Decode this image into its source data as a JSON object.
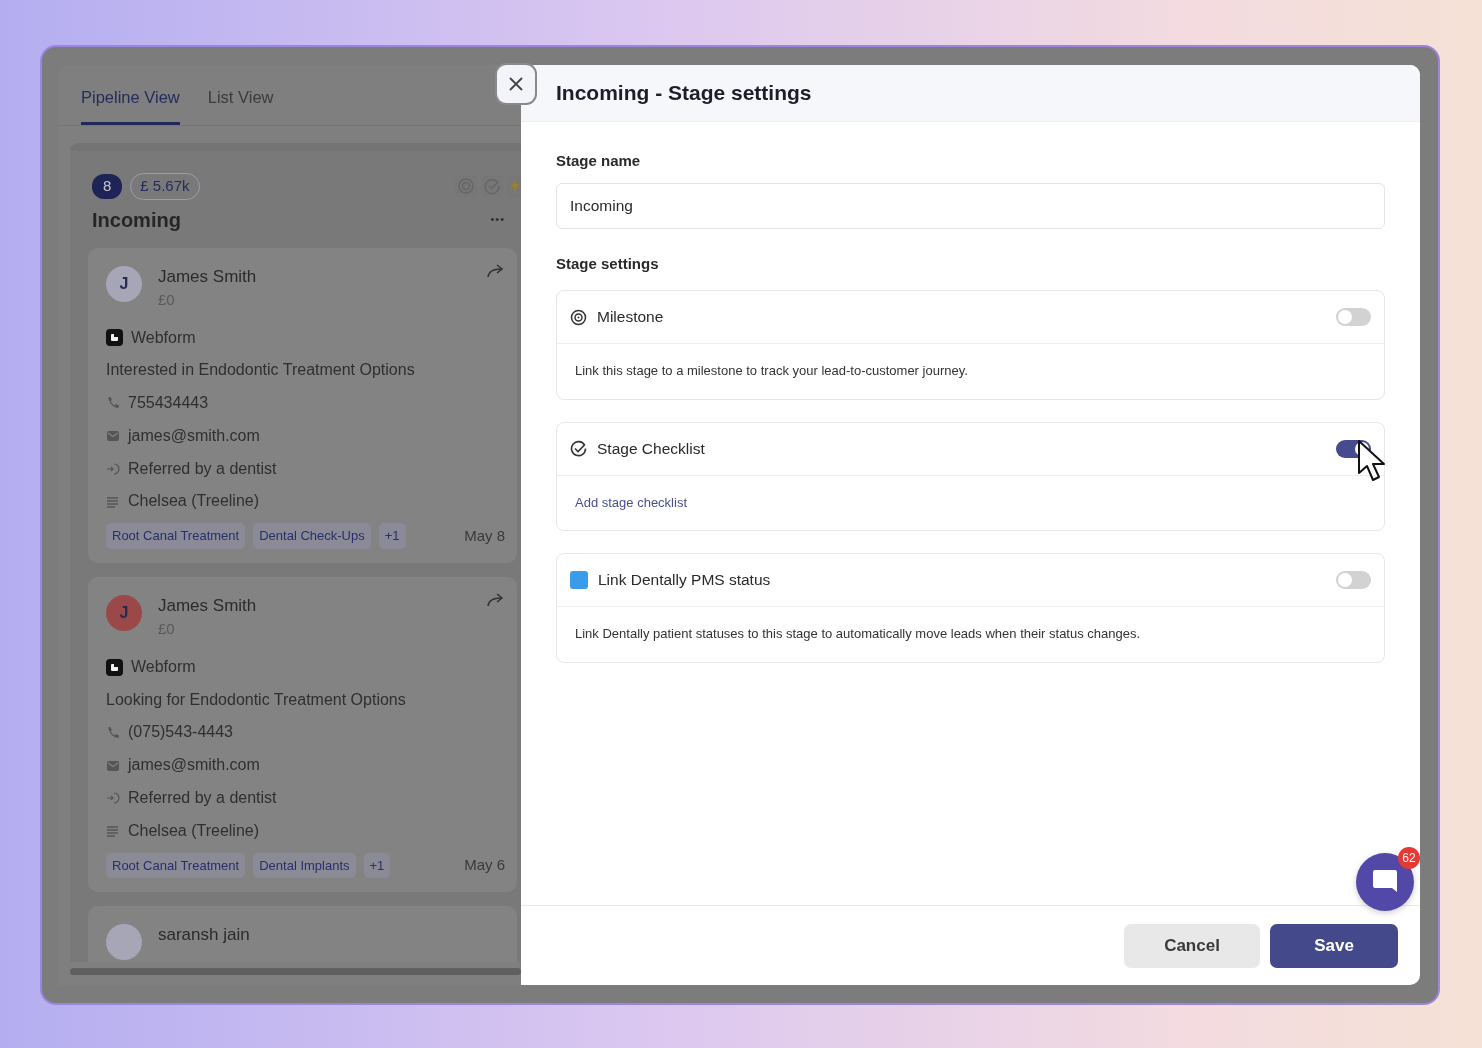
{
  "tabs": [
    {
      "label": "Pipeline View",
      "selected": true
    },
    {
      "label": "List View",
      "selected": false
    }
  ],
  "column": {
    "count": "8",
    "value": "£ 5.67k",
    "title": "Incoming",
    "menu": "•••",
    "cards": [
      {
        "initial": "J",
        "color": "#a7a6b6",
        "name": "James Smith",
        "amount": "£0",
        "source": "Webform",
        "description": "Interested in Endodontic Treatment Options",
        "phone": "755434443",
        "email": "james@smith.com",
        "referral": "Referred by a dentist",
        "location": "Chelsea (Treeline)",
        "tags": [
          "Root Canal Treatment",
          "Dental Check-Ups"
        ],
        "more": "+1",
        "date": "May 8"
      },
      {
        "initial": "J",
        "color": "#9a4848",
        "name": "James Smith",
        "amount": "£0",
        "source": "Webform",
        "description": "Looking for Endodontic Treatment Options",
        "phone": "(075)543-4443",
        "email": "james@smith.com",
        "referral": "Referred by a dentist",
        "location": "Chelsea (Treeline)",
        "tags": [
          "Root Canal Treatment",
          "Dental Implants"
        ],
        "more": "+1",
        "date": "May 6"
      },
      {
        "color": "#a7a6b6",
        "name": "saransh jain"
      }
    ]
  },
  "modal": {
    "title": "Incoming - Stage settings",
    "stage_name_label": "Stage name",
    "stage_name": "Incoming",
    "settings_label": "Stage settings",
    "settings": [
      {
        "kind": "milestone",
        "title": "Milestone",
        "on": false,
        "description": "Link this stage to a milestone to track your lead-to-customer journey."
      },
      {
        "kind": "checklist",
        "title": "Stage Checklist",
        "on": true,
        "link": "Add stage checklist"
      },
      {
        "kind": "dentally",
        "title": "Link Dentally PMS status",
        "on": false,
        "description": "Link Dentally patient statuses to this stage to automatically move leads when their status changes."
      }
    ],
    "buttons": [
      {
        "label": "Cancel",
        "kind": "secondary"
      },
      {
        "label": "Save",
        "kind": "primary"
      }
    ]
  },
  "chat": {
    "badge": "62"
  }
}
